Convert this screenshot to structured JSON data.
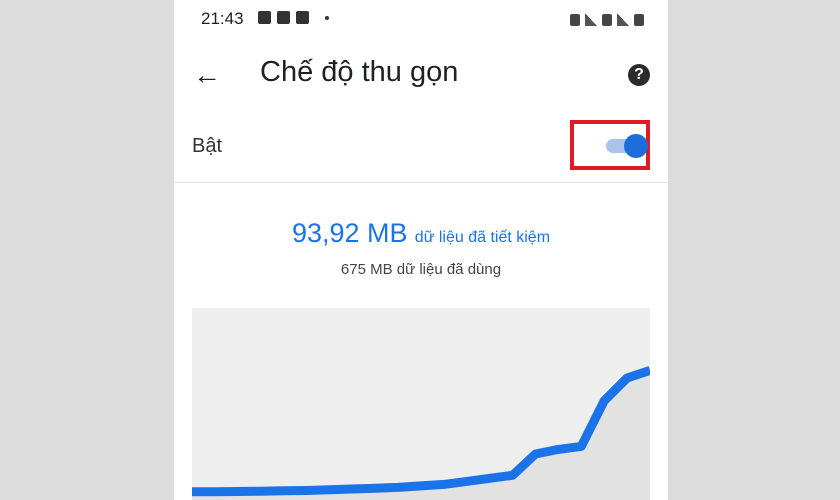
{
  "status_bar": {
    "time": "21:43"
  },
  "app_bar": {
    "title": "Chế độ thu gọn",
    "back_icon": "arrow-left-icon",
    "help_icon": "help-circle-icon"
  },
  "toggle": {
    "label": "Bật",
    "enabled": true,
    "accent_color": "#1a73e8",
    "highlight_color": "#e01a22"
  },
  "savings": {
    "saved_amount": "93,92 MB",
    "saved_text": "dữ liệu đã tiết kiệm",
    "used_text": "675 MB dữ liệu đã dùng"
  },
  "chart_data": {
    "type": "area",
    "x": [
      0,
      1,
      2,
      3,
      4,
      5,
      6,
      7,
      8,
      9,
      10,
      11,
      12,
      13,
      14,
      15,
      16,
      17,
      18,
      19,
      20
    ],
    "series": [
      {
        "values": [
          0.2,
          0.2,
          0.3,
          0.5,
          0.8,
          1,
          1.5,
          2,
          2.5,
          3,
          4,
          5,
          7,
          9,
          11,
          25,
          28,
          30,
          60,
          75,
          80
        ]
      }
    ],
    "xlabel": "",
    "ylabel": "",
    "ylim": [
      0,
      100
    ],
    "grid": false,
    "color": "#1a73e8"
  }
}
